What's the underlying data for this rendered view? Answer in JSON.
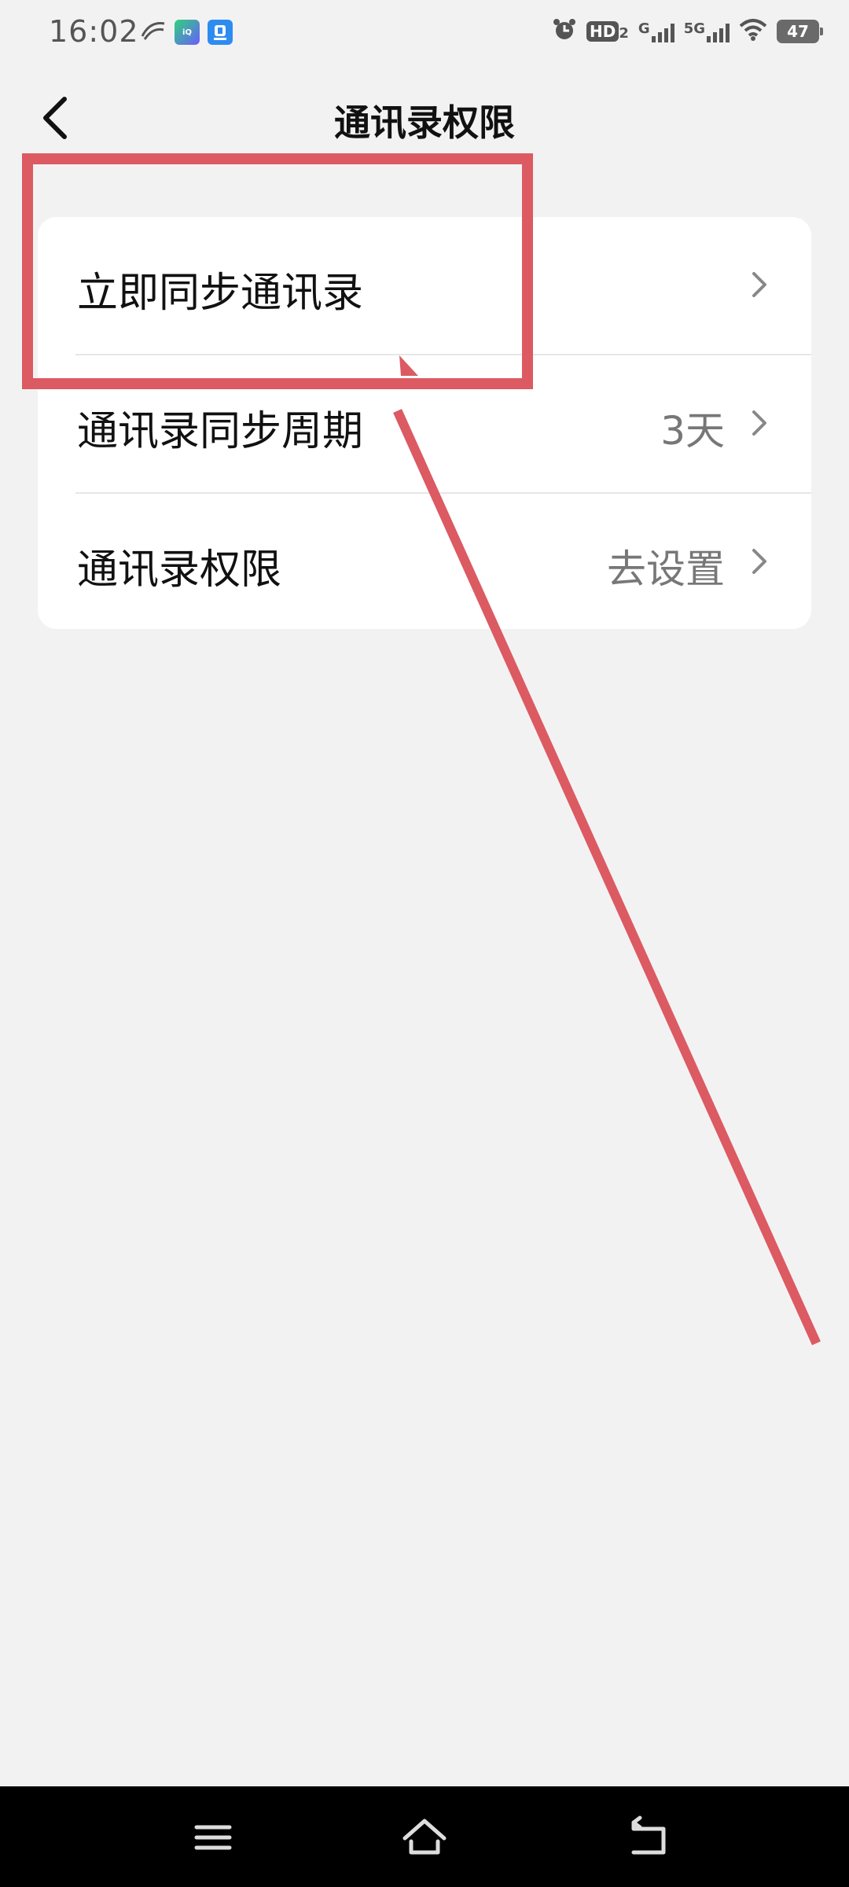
{
  "status_bar": {
    "time": "16:02",
    "hd_label": "HD",
    "hd_sub": "2",
    "net1": "G",
    "net2": "5G",
    "battery": "47",
    "app_icons": [
      "swoosh-icon",
      "iqiyi-app-icon",
      "alarm-app-icon"
    ]
  },
  "header": {
    "title": "通讯录权限",
    "back_icon": "chevron-left-icon"
  },
  "settings": {
    "items": [
      {
        "label": "立即同步通讯录",
        "value": ""
      },
      {
        "label": "通讯录同步周期",
        "value": "3天"
      },
      {
        "label": "通讯录权限",
        "value": "去设置"
      }
    ]
  },
  "nav": {
    "menu_icon": "menu-icon",
    "home_icon": "home-icon",
    "back_icon": "back-icon"
  },
  "colors": {
    "background": "#f3f2f3",
    "card": "#ffffff",
    "annotation": "#dc5a62",
    "value_text": "#777777",
    "nav_bar": "#000000"
  }
}
